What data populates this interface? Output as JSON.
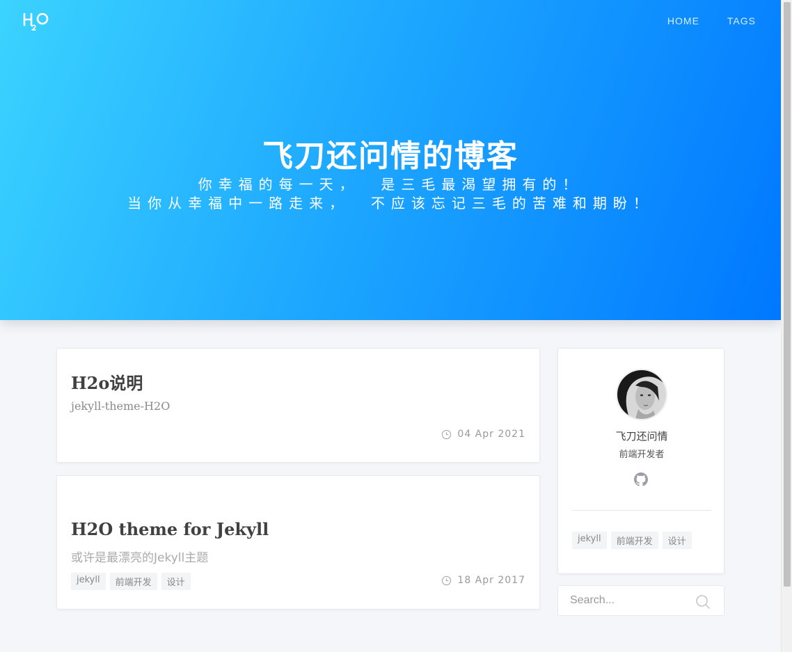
{
  "header": {
    "logo_alt": "H2O",
    "nav": [
      {
        "label": "HOME"
      },
      {
        "label": "TAGS"
      }
    ],
    "title": "飞刀还问情的博客",
    "description_lines": [
      "你幸福的每一天，  是三毛最渴望拥有的！",
      "当你从幸福中一路走来，  不应该忘记三毛的苦难和期盼！"
    ]
  },
  "posts": [
    {
      "title": "H2o说明",
      "subtitle": "jekyll-theme-H2O",
      "date": "04 Apr 2021",
      "tags": []
    },
    {
      "title": "H2O theme for Jekyll",
      "subtitle": "或许是最漂亮的Jekyll主题",
      "date": "18 Apr 2017",
      "tags": [
        "jekyll",
        "前端开发",
        "设计"
      ]
    }
  ],
  "sidebar": {
    "author_name": "飞刀还问情",
    "author_bio": "前端开发者",
    "social_icon": "github-icon",
    "tags": [
      "jekyll",
      "前端开发",
      "设计"
    ]
  },
  "search": {
    "placeholder": "Search..."
  },
  "colors": {
    "hero_start": "#3bd3ff",
    "hero_end": "#0078ff",
    "page_bg": "#f5f6f9"
  }
}
